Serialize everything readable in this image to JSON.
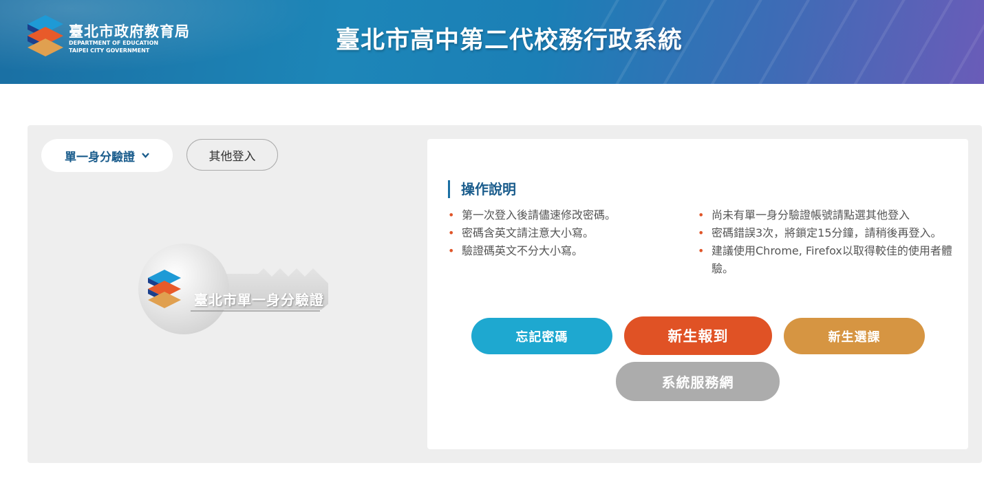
{
  "header": {
    "logo_zh": "臺北市政府教育局",
    "logo_en_line1": "DEPARTMENT OF EDUCATION",
    "logo_en_line2": "TAIPEI CITY GOVERNMENT",
    "site_title": "臺北市高中第二代校務行政系統"
  },
  "login": {
    "tab_sso_label": "單一身分驗證",
    "tab_sso_icon": "chevron-down-icon",
    "tab_other_label": "其他登入",
    "key_graphic_text": "臺北市單一身分驗證"
  },
  "instructions": {
    "title": "操作說明",
    "left_notes": [
      "第一次登入後請儘速修改密碼。",
      "密碼含英文請注意大小寫。",
      "驗證碼英文不分大小寫。"
    ],
    "right_notes": [
      "尚未有單一身分驗證帳號請點選其他登入",
      "密碼錯誤3次，將鎖定15分鐘，請稍後再登入。",
      "建議使用Chrome, Firefox以取得較佳的使用者體驗。"
    ]
  },
  "buttons": {
    "forgot_password": "忘記密碼",
    "new_student_register": "新生報到",
    "new_student_course": "新生選課",
    "system_service": "系統服務網"
  },
  "colors": {
    "brand_blue": "#1a6fa3",
    "forgot_btn": "#1ea8d0",
    "enroll_btn": "#e05225",
    "course_btn": "#d69542",
    "service_btn": "#acacac",
    "bullet": "#e0562a"
  }
}
